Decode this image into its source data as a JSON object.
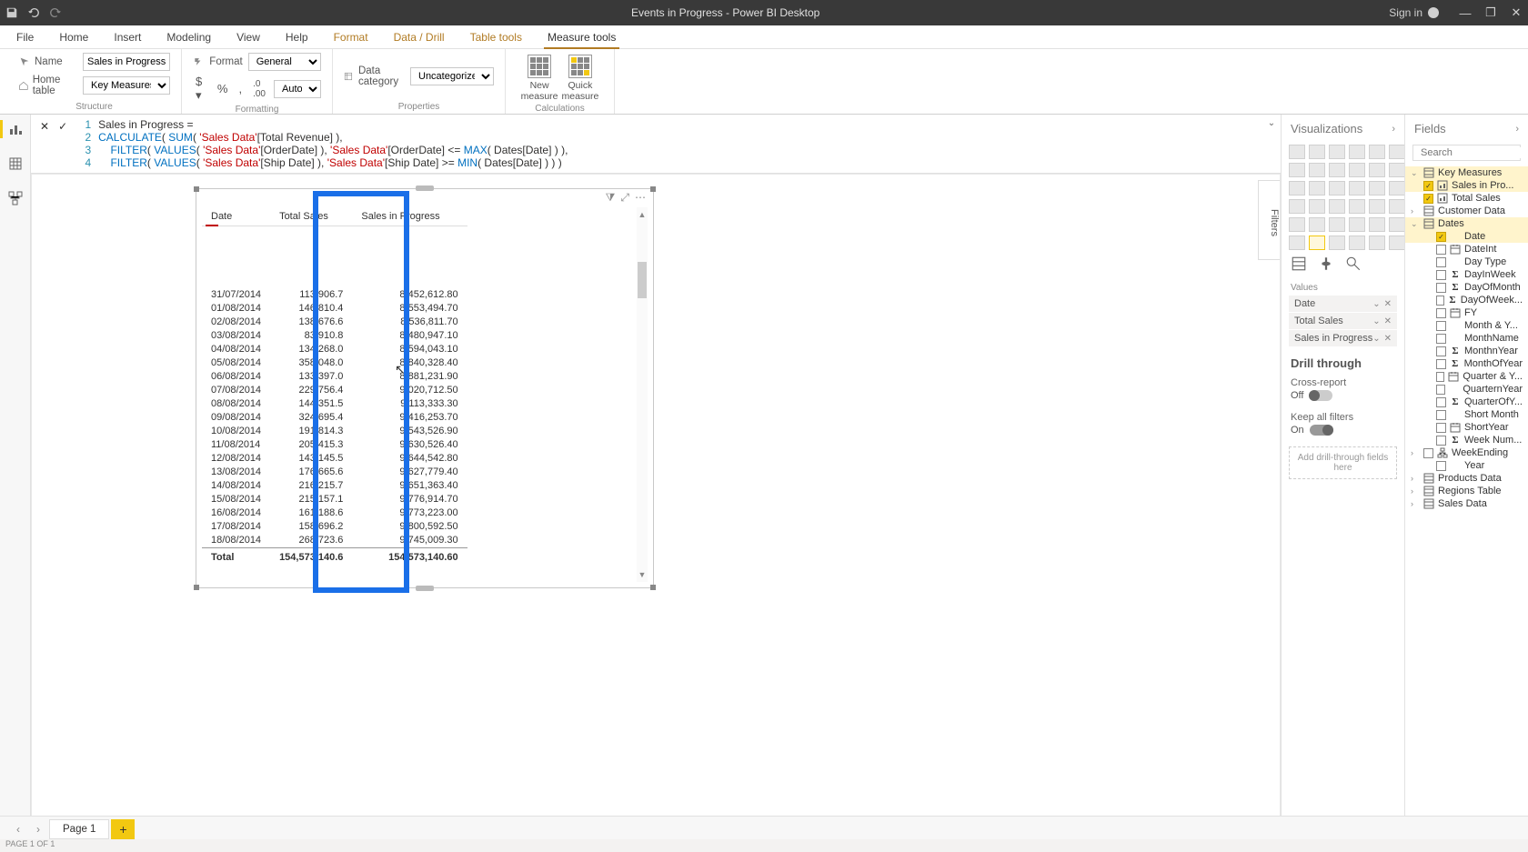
{
  "title": "Events in Progress - Power BI Desktop",
  "titlebar": {
    "signin": "Sign in"
  },
  "ribbonTabs": {
    "file": "File",
    "list": [
      "Home",
      "Insert",
      "Modeling",
      "View",
      "Help"
    ],
    "context": [
      "Format",
      "Data / Drill",
      "Table tools",
      "Measure tools"
    ],
    "active": "Measure tools"
  },
  "ribbon": {
    "structure": {
      "name_label": "Name",
      "name_value": "Sales in Progress",
      "home_label": "Home table",
      "home_value": "Key Measures",
      "group": "Structure"
    },
    "formatting": {
      "format_label": "Format",
      "format_value": "General",
      "auto": "Auto",
      "group": "Formatting"
    },
    "properties": {
      "datacat_label": "Data category",
      "datacat_value": "Uncategorized",
      "group": "Properties"
    },
    "calculations": {
      "new": "New\nmeasure",
      "quick": "Quick\nmeasure",
      "group": "Calculations"
    }
  },
  "formula": {
    "l1": "Sales in Progress =",
    "l2a": "CALCULATE",
    "l2b": "SUM",
    "l2c": "'Sales Data'",
    "l2d": "[Total Revenue] ),",
    "l3a": "FILTER",
    "l3b": "VALUES",
    "l3c": "'Sales Data'",
    "l3d": "[OrderDate] ), ",
    "l3e": "'Sales Data'",
    "l3f": "[OrderDate] <= ",
    "l3g": "MAX",
    "l3h": "( Dates[Date] ) ),",
    "l4a": "FILTER",
    "l4b": "VALUES",
    "l4c": "'Sales Data'",
    "l4d": "[Ship Date] ), ",
    "l4e": "'Sales Data'",
    "l4f": "[Ship Date] >= ",
    "l4g": "MIN",
    "l4h": "( Dates[Date] ) ) )"
  },
  "table": {
    "h1": "Date",
    "h2": "Total Sales",
    "h3": "Sales in Progress",
    "rows": [
      [
        "31/07/2014",
        "113,906.7",
        "8,452,612.80"
      ],
      [
        "01/08/2014",
        "146,810.4",
        "8,553,494.70"
      ],
      [
        "02/08/2014",
        "138,676.6",
        "8,536,811.70"
      ],
      [
        "03/08/2014",
        "83,910.8",
        "8,480,947.10"
      ],
      [
        "04/08/2014",
        "134,268.0",
        "8,594,043.10"
      ],
      [
        "05/08/2014",
        "358,048.0",
        "8,840,328.40"
      ],
      [
        "06/08/2014",
        "133,397.0",
        "8,881,231.90"
      ],
      [
        "07/08/2014",
        "229,756.4",
        "9,020,712.50"
      ],
      [
        "08/08/2014",
        "144,351.5",
        "9,113,333.30"
      ],
      [
        "09/08/2014",
        "324,695.4",
        "9,416,253.70"
      ],
      [
        "10/08/2014",
        "191,814.3",
        "9,543,526.90"
      ],
      [
        "11/08/2014",
        "205,415.3",
        "9,630,526.40"
      ],
      [
        "12/08/2014",
        "143,145.5",
        "9,644,542.80"
      ],
      [
        "13/08/2014",
        "176,665.6",
        "9,627,779.40"
      ],
      [
        "14/08/2014",
        "216,215.7",
        "9,651,363.40"
      ],
      [
        "15/08/2014",
        "215,157.1",
        "9,776,914.70"
      ],
      [
        "16/08/2014",
        "161,188.6",
        "9,773,223.00"
      ],
      [
        "17/08/2014",
        "158,696.2",
        "9,800,592.50"
      ],
      [
        "18/08/2014",
        "268,723.6",
        "9,745,009.30"
      ]
    ],
    "total_label": "Total",
    "total_c2": "154,573,140.6",
    "total_c3": "154,573,140.60"
  },
  "filtersTab": "Filters",
  "viz": {
    "header": "Visualizations",
    "values_label": "Values",
    "wells": [
      "Date",
      "Total Sales",
      "Sales in Progress"
    ],
    "drill_header": "Drill through",
    "cross": "Cross-report",
    "off": "Off",
    "keep": "Keep all filters",
    "on": "On",
    "drop": "Add drill-through fields here"
  },
  "fields": {
    "header": "Fields",
    "search_ph": "Search",
    "tables": {
      "keymeasures": "Key Measures",
      "km_items": [
        "Sales in Pro...",
        "Total Sales"
      ],
      "customer": "Customer Data",
      "dates": "Dates",
      "date_items": [
        "Date",
        "DateInt",
        "Day Type",
        "DayInWeek",
        "DayOfMonth",
        "DayOfWeek...",
        "FY",
        "Month & Y...",
        "MonthName",
        "MonthnYear",
        "MonthOfYear",
        "Quarter & Y...",
        "QuarternYear",
        "QuarterOfY...",
        "Short Month",
        "ShortYear",
        "Week Num...",
        "WeekEnding",
        "Year"
      ],
      "date_checked": [
        0
      ],
      "date_sigma": [
        3,
        4,
        5,
        9,
        10,
        13,
        16
      ],
      "date_cal": [
        1,
        6,
        11,
        15
      ],
      "date_hier": [
        17
      ],
      "products": "Products Data",
      "regions": "Regions Table",
      "sales": "Sales Data"
    }
  },
  "pagetabs": {
    "page1": "Page 1"
  },
  "status": "PAGE 1 OF 1"
}
